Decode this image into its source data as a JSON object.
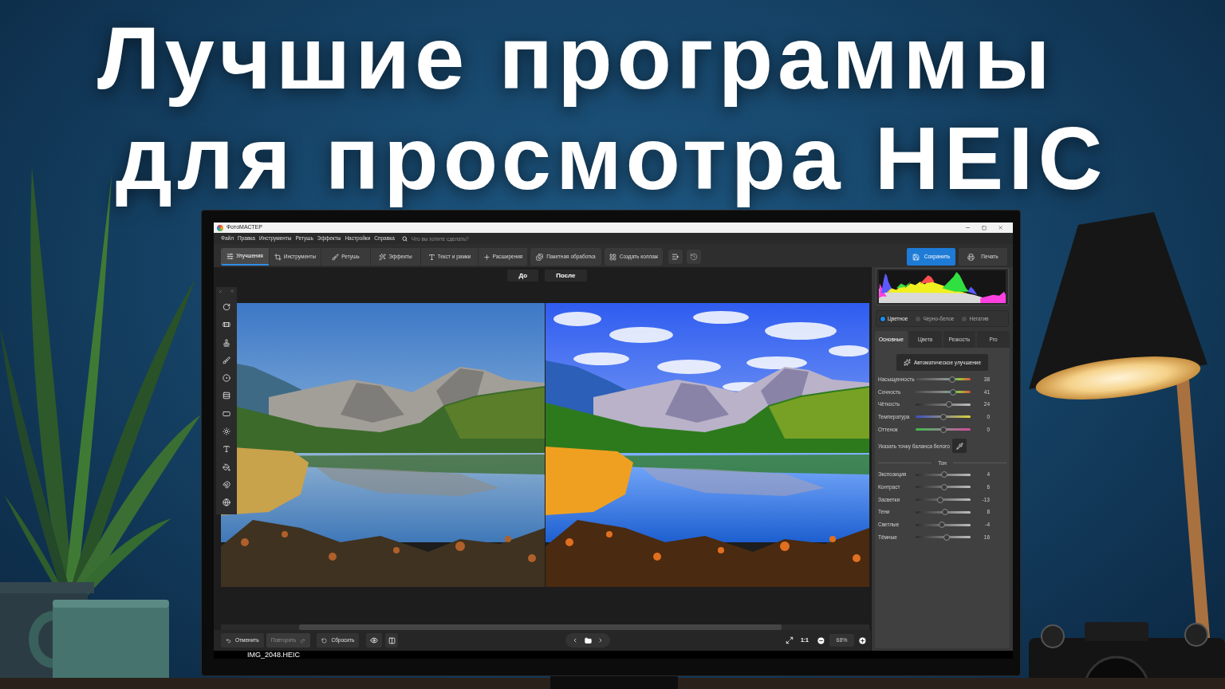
{
  "headline": [
    "Лучшие программы",
    "для просмотра HEIC"
  ],
  "app": {
    "window": {
      "title": "ФотоМАСТЕР"
    },
    "menu": [
      "Файл",
      "Правка",
      "Инструменты",
      "Ретушь",
      "Эффекты",
      "Настройки",
      "Справка"
    ],
    "search": {
      "placeholder": "Что вы хотите сделать?"
    },
    "tabs": [
      {
        "label": "Улучшения",
        "selected": true
      },
      {
        "label": "Инструменты",
        "selected": false
      },
      {
        "label": "Ретушь",
        "selected": false
      },
      {
        "label": "Эффекты",
        "selected": false
      },
      {
        "label": "Текст и рамки",
        "selected": false
      },
      {
        "label": "Расширения",
        "selected": false
      }
    ],
    "toolbar_buttons": [
      "Пакетная обработка",
      "Создать коллаж"
    ],
    "save_button": "Сохранить",
    "print_button": "Печать",
    "view_buttons": [
      "До",
      "После"
    ],
    "color_modes": [
      {
        "label": "Цветное",
        "selected": true
      },
      {
        "label": "Черно-белое",
        "selected": false
      },
      {
        "label": "Негатив",
        "selected": false
      }
    ],
    "panel_tabs": [
      {
        "label": "Основные",
        "selected": true
      },
      {
        "label": "Цвета",
        "selected": false
      },
      {
        "label": "Резкость",
        "selected": false
      },
      {
        "label": "Pro",
        "selected": false
      }
    ],
    "auto_button": "Автоматическое улучшение",
    "color_sliders": [
      {
        "label": "Насыщенность",
        "kind": "saturation",
        "level": 0.69,
        "reading": "38"
      },
      {
        "label": "Сочность",
        "kind": "saturation",
        "level": 0.705,
        "reading": "41"
      },
      {
        "label": "Чёткость",
        "kind": "gray",
        "level": 0.62,
        "reading": "24"
      },
      {
        "label": "Температура",
        "kind": "temperature",
        "level": 0.5,
        "reading": "0"
      },
      {
        "label": "Оттенок",
        "kind": "tint",
        "level": 0.5,
        "reading": "0"
      }
    ],
    "white_balance": "Указать точку баланса белого",
    "tone": {
      "title": "Тон",
      "sliders": [
        {
          "label": "Экспозиция",
          "kind": "gray",
          "level": 0.52,
          "reading": "4"
        },
        {
          "label": "Контраст",
          "kind": "gray",
          "level": 0.53,
          "reading": "6"
        },
        {
          "label": "Засветки",
          "kind": "gray",
          "level": 0.435,
          "reading": "-13"
        },
        {
          "label": "Тени",
          "kind": "gray",
          "level": 0.54,
          "reading": "8"
        },
        {
          "label": "Светлые",
          "kind": "gray",
          "level": 0.48,
          "reading": "-4"
        },
        {
          "label": "Тёмные",
          "kind": "gray",
          "level": 0.58,
          "reading": "16"
        }
      ]
    },
    "history_buttons": [
      {
        "kind": "undo",
        "label": "Отменить",
        "disabled": false
      },
      {
        "kind": "redo",
        "label": "Повторить",
        "disabled": true
      },
      {
        "kind": "reset",
        "label": "Сбросить",
        "disabled": false
      }
    ],
    "zoom": {
      "one_to_one": "1:1",
      "percent": "68%"
    },
    "file_name": "IMG_2048.HEIC"
  }
}
